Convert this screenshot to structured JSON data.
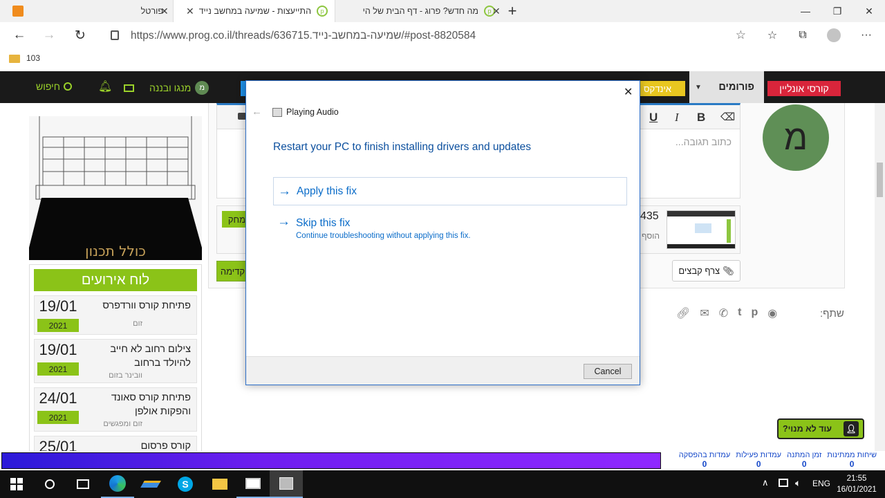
{
  "browser": {
    "tabs": [
      {
        "title": "פורטל",
        "close": "✕"
      },
      {
        "title": "התייעצות - שמיעה במחשב נייד",
        "close": "✕"
      },
      {
        "title": "מה חדש? פרוג - דף הבית של הי",
        "close": "✕"
      }
    ],
    "new_tab": "+",
    "url": "https://www.prog.co.il/threads/636715.שמיעה-במחשב-נייד/#post-8820584",
    "favorites_folder": "103"
  },
  "site": {
    "nav": {
      "online_courses": "קורסי אונליין",
      "forums": "פורומים",
      "index": "אינדקס",
      "search": "חיפוש",
      "username": "מנגו ובננה",
      "avatar_letter": "מ"
    },
    "editor": {
      "placeholder": "כתוב תגובה...",
      "attach_files": "צרף קבצים",
      "bold": "B",
      "italic": "I",
      "underline": "U",
      "avatar_letter": "מ",
      "thumb_number": "435",
      "thumb_label": "הוסף",
      "btn_left_1": "מחק",
      "btn_left_2": "קדימה"
    },
    "share": {
      "label": "שתף:"
    },
    "events": {
      "title": "לוח אירועים",
      "items": [
        {
          "day": "19/01",
          "year": "2021",
          "title": "פתיחת קורס וורדפרס",
          "sub": "זום"
        },
        {
          "day": "19/01",
          "year": "2021",
          "title": "צילום רחוב לא חייב להיולד ברחוב",
          "sub": "וובינר בזום"
        },
        {
          "day": "24/01",
          "year": "2021",
          "title": "פתיחת קורס סאונד והפקות אולפן",
          "sub": "זום ומפגשים"
        },
        {
          "day": "25/01",
          "year": "",
          "title": "קורס פרסום",
          "sub": ""
        }
      ]
    },
    "sidebar_image_caption": "כולל תכנון",
    "subscribe_btn": "עוד לא מנוי?",
    "stats": [
      {
        "label": "שיחות ממתינות",
        "value": "0"
      },
      {
        "label": "זמן המתנה",
        "value": "0"
      },
      {
        "label": "עמדות פעילות",
        "value": "0"
      },
      {
        "label": "עמדות בהפסקה",
        "value": "0"
      }
    ]
  },
  "dialog": {
    "header_title": "Playing Audio",
    "heading": "Restart your PC to finish installing drivers and updates",
    "options": [
      {
        "title": "Apply this fix",
        "subtitle": ""
      },
      {
        "title": "Skip this fix",
        "subtitle": "Continue troubleshooting without applying this fix."
      }
    ],
    "cancel": "Cancel"
  },
  "taskbar": {
    "lang": "ENG",
    "time": "21:55",
    "date": "16/01/2021"
  },
  "colors": {
    "accent_green": "#8bc318",
    "dialog_blue": "#0063b1",
    "link_blue": "#0078d7"
  }
}
